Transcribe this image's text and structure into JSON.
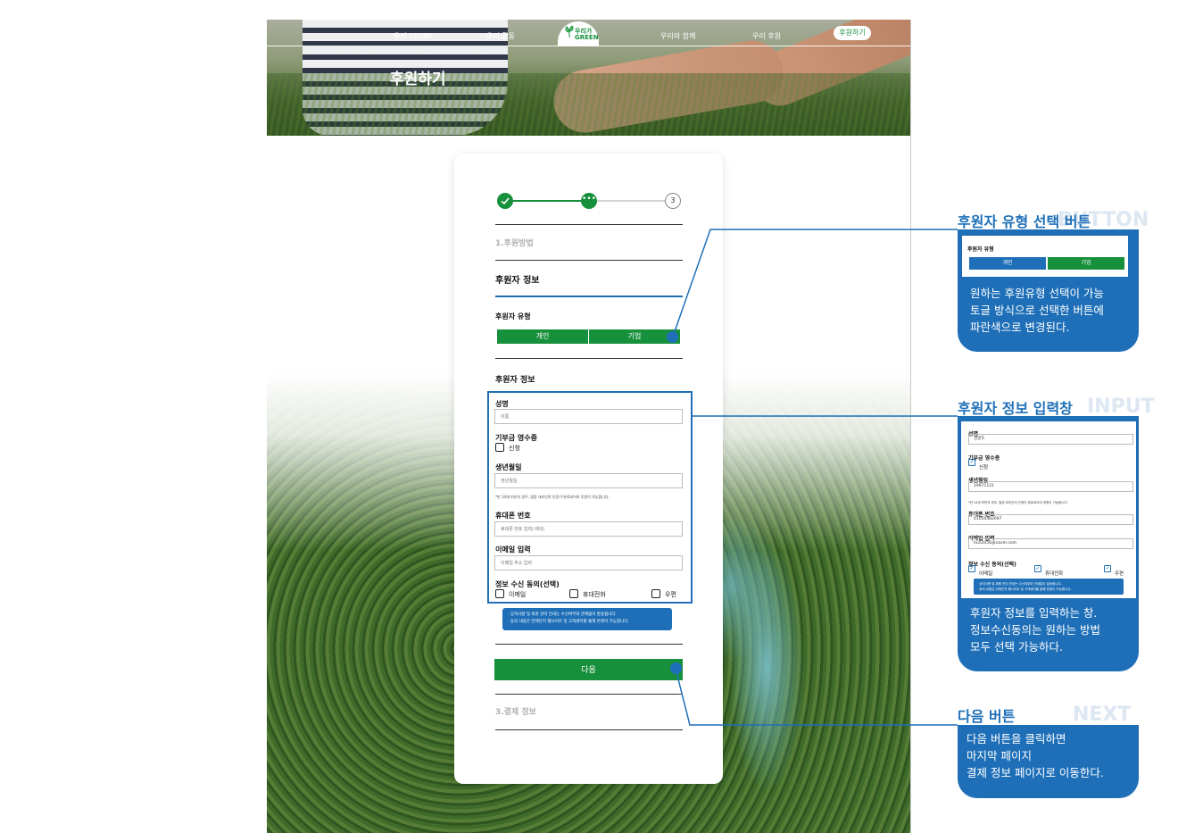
{
  "nav": {
    "items": [
      "우리 STORY",
      "우리 활동",
      "우리와 함께",
      "우리 후원"
    ],
    "cta": "후원하기",
    "logo_top": "우리가",
    "logo_bottom": "GREEN"
  },
  "hero": {
    "title": "후원하기"
  },
  "steps": {
    "done_icon": "check-icon",
    "current": "•••",
    "next": "3"
  },
  "form": {
    "section1": "1.후원방법",
    "section2": "후원자 정보",
    "donor_type_label": "후원자 유형",
    "type_buttons": [
      "개인",
      "기업"
    ],
    "donor_info_title": "후원자 정보",
    "name_label": "성명",
    "name_placeholder": "이름",
    "receipt_label": "기부금 영수증",
    "receipt_option": "신청",
    "birth_label": "생년월일",
    "birth_placeholder": "생년월일",
    "birth_note": "*만 14세 미만의 경우, 법정 대리인의 인증이 완료되어야 후원이 가능합니다.",
    "phone_label": "휴대폰 번호",
    "phone_placeholder": "휴대폰 번호 입력(-제외)",
    "email_label": "이메일 입력",
    "email_placeholder": "이메일 주소 입력",
    "consent_label": "정보 수신 동의(선택)",
    "consent_options": [
      "이메일",
      "휴대전화",
      "우편"
    ],
    "info_lines": [
      "· 공지사항 및 회원 관리 안내는 수신여부와 관계없이 발송됩니다.",
      "· 동의 내용은 언제든지 웹사이트 및 고객센터를 통해 변경이 가능합니다."
    ],
    "next_button": "다음",
    "section3": "3.결제 정보"
  },
  "annotations": {
    "button": {
      "title": "후원자 유형 선택 버튼",
      "bg_word": "BUTTON",
      "mini_label": "후원자 유형",
      "mini_buttons": [
        "개인",
        "기업"
      ],
      "lines": [
        "원하는 후원유형 선택이 가능",
        "토글 방식으로 선택한 버튼에",
        "파란색으로 변경된다."
      ]
    },
    "input": {
      "title": "후원자 정보 입력창",
      "bg_word": "INPUT",
      "name_label": "성명",
      "name_value": "김영호",
      "receipt_label": "기부금 영수증",
      "receipt_option": "신청",
      "birth_label": "생년월일",
      "birth_value": "19971121",
      "birth_note": "*만 14세 미만의 경우, 법정 대리인의 인증이 완료되어야 후원이 가능합니다.",
      "phone_label": "휴대폰 번호",
      "phone_value": "01050482697",
      "email_label": "이메일 입력",
      "email_value": "hun2056@naver.com",
      "consent_label": "정보 수신 동의(선택)",
      "consent_options": [
        "이메일",
        "휴대전화",
        "우편"
      ],
      "info_lines": [
        "· 공지사항 및 회원 관리 안내는 수신여부와 관계없이 발송됩니다.",
        "· 동의 내용은 언제든지 웹사이트 및 고객센터를 통해 변경이 가능합니다."
      ],
      "lines": [
        "후원자 정보를 입력하는 창.",
        "정보수신동의는 원하는 방법",
        "모두 선택 가능하다."
      ]
    },
    "next": {
      "title": "다음 버튼",
      "bg_word": "NEXT",
      "lines": [
        "다음 버튼을 클릭하면",
        "마지막 페이지",
        "결제 정보 페이지로 이동한다."
      ]
    }
  },
  "colors": {
    "green": "#17903c",
    "blue": "#1e6fb8"
  }
}
